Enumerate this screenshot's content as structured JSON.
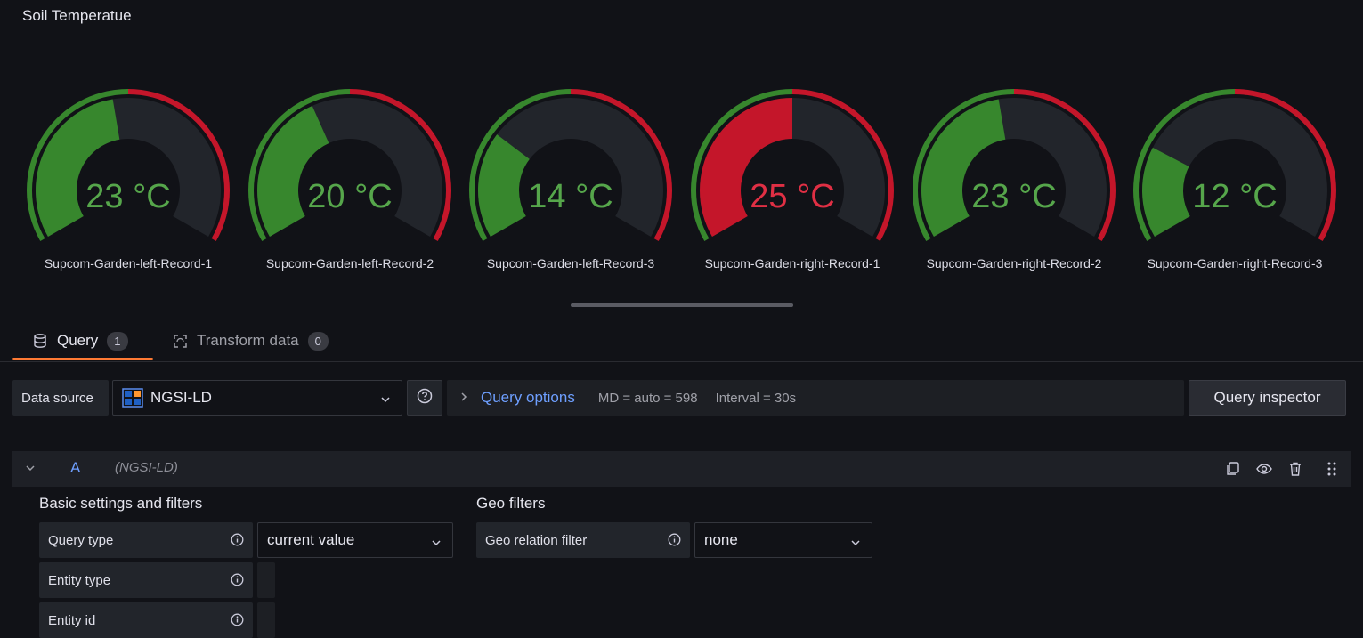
{
  "panel": {
    "title": "Soil Temperatue"
  },
  "gauges": [
    {
      "value": 23,
      "display": "23 °C",
      "label": "Supcom-Garden-left-Record-1",
      "status": "green"
    },
    {
      "value": 20,
      "display": "20 °C",
      "label": "Supcom-Garden-left-Record-2",
      "status": "green"
    },
    {
      "value": 14,
      "display": "14 °C",
      "label": "Supcom-Garden-left-Record-3",
      "status": "green"
    },
    {
      "value": 25,
      "display": "25 °C",
      "label": "Supcom-Garden-right-Record-1",
      "status": "red"
    },
    {
      "value": 23,
      "display": "23 °C",
      "label": "Supcom-Garden-right-Record-2",
      "status": "green"
    },
    {
      "value": 12,
      "display": "12 °C",
      "label": "Supcom-Garden-right-Record-3",
      "status": "green"
    }
  ],
  "gauge_config": {
    "min": 0,
    "max": 50,
    "threshold": 25,
    "unit": "°C"
  },
  "colors": {
    "green": "#37872d",
    "green_text": "#56a64b",
    "red": "#c4162a",
    "red_text": "#e02f44",
    "track": "#22252b",
    "accent": "#6e9fff",
    "tab_underline": "#ff7a34"
  },
  "tabs": [
    {
      "label": "Query",
      "count": "1",
      "icon": "database-icon",
      "active": true
    },
    {
      "label": "Transform data",
      "count": "0",
      "icon": "transform-icon",
      "active": false
    }
  ],
  "datasource": {
    "label": "Data source",
    "selected": "NGSI-LD",
    "icon": "ngsi-ld-logo",
    "help_icon": "question-circle-icon"
  },
  "query_options": {
    "title": "Query options",
    "md": "MD = auto = 598",
    "interval": "Interval = 30s"
  },
  "query_inspector": {
    "label": "Query inspector"
  },
  "query_row": {
    "ref_id": "A",
    "datasource": "(NGSI-LD)",
    "actions": [
      "copy-icon",
      "eye-icon",
      "trash-icon",
      "drag-handle-icon"
    ]
  },
  "sections": {
    "basic": "Basic settings and filters",
    "geo": "Geo filters"
  },
  "fields": {
    "query_type": {
      "label": "Query type",
      "value": "current value"
    },
    "entity_type": {
      "label": "Entity type"
    },
    "entity_id": {
      "label": "Entity id"
    },
    "geo_relation": {
      "label": "Geo relation filter",
      "value": "none"
    }
  }
}
